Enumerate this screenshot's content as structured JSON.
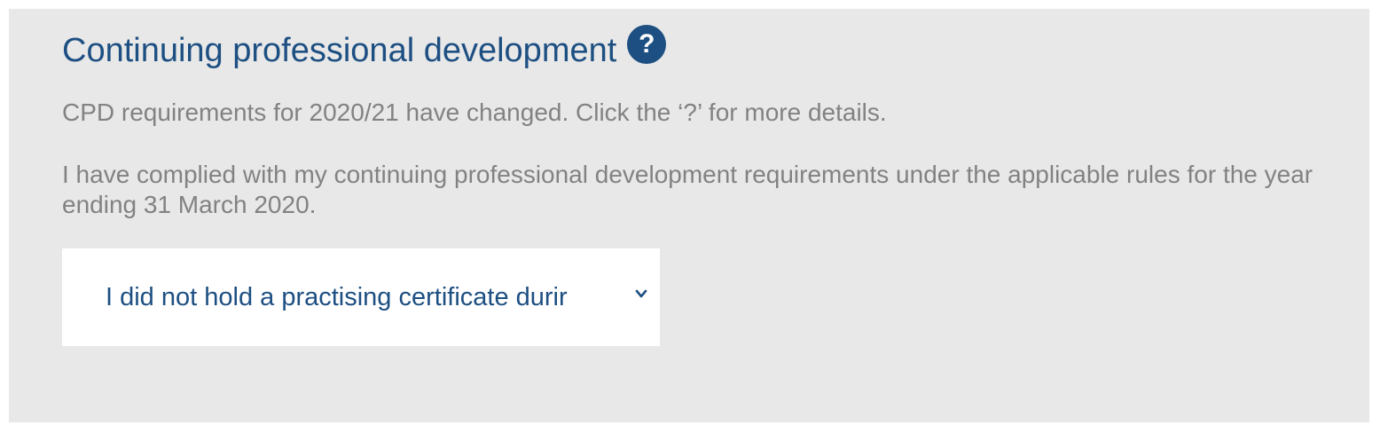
{
  "section": {
    "title": "Continuing professional development",
    "help_icon": "question-mark-circle-icon",
    "help_glyph": "?",
    "notice": "CPD requirements for 2020/21 have changed. Click the ‘?’ for more details.",
    "statement": "I have complied with my continuing professional development requirements under the applicable rules for the year ending 31 March 2020."
  },
  "select": {
    "selected_value": "I did not hold a practising certificate durir",
    "icon": "chevron-down-icon"
  },
  "colors": {
    "panel_background": "#e8e8e8",
    "heading": "#1d4f82",
    "body_text": "#828282",
    "select_background": "#ffffff"
  }
}
